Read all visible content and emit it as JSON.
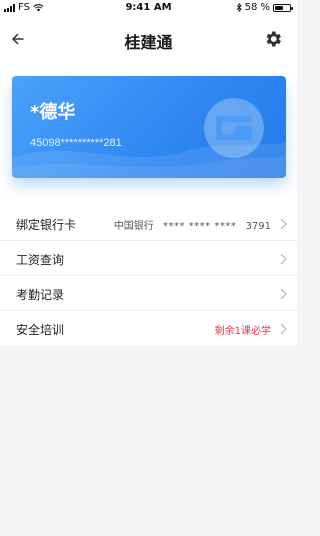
{
  "status_bar": {
    "carrier": "FS",
    "time": "9:41 AM",
    "battery_text": "58 %",
    "battery_level": 0.58
  },
  "nav": {
    "title": "桂建通",
    "back_icon": "arrow-left-icon",
    "settings_icon": "gear-icon"
  },
  "card": {
    "name": "*德华",
    "id_number": "45098**********281",
    "logo_icon": "guijian-logo-icon"
  },
  "menu": [
    {
      "label": "绑定银行卡",
      "bank": "中国银行",
      "mask": "**** **** ****",
      "last4": "3791"
    },
    {
      "label": "工资查询"
    },
    {
      "label": "考勤记录"
    },
    {
      "label": "安全培训",
      "note": "剩余1课必学"
    }
  ],
  "colors": {
    "accent": "#2e86f2",
    "warning": "#f0344a"
  }
}
